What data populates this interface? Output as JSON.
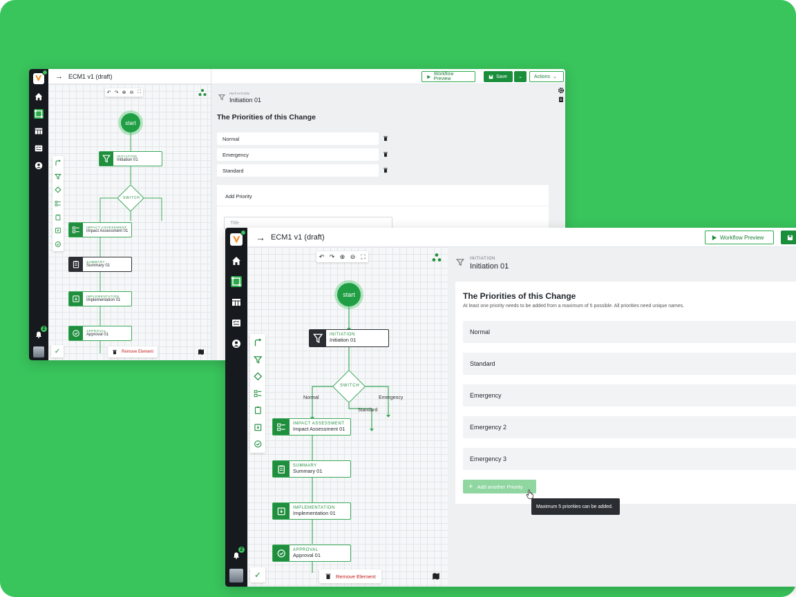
{
  "app": {
    "window_title": "ECM1 v1 (draft)",
    "notification_count": "2"
  },
  "toolbar": {
    "preview_label": "Workflow Preview",
    "save_label": "Save",
    "actions_label": "Actions"
  },
  "canvas": {
    "start_label": "start",
    "switch_label": "SWITCH",
    "remove_label": "Remove Element",
    "edge_labels": [
      "Normal",
      "Standard",
      "Emergency"
    ],
    "nodes": [
      {
        "kind": "INITIATION",
        "name": "Initiation 01",
        "icon": "filter-icon"
      },
      {
        "kind": "IMPACT ASSESSMENT",
        "name": "Impact Assessment 01",
        "icon": "checklist-icon"
      },
      {
        "kind": "SUMMARY",
        "name": "Summary 01",
        "icon": "clipboard-icon"
      },
      {
        "kind": "IMPLEMENTATION",
        "name": "Implementation 01",
        "icon": "inbox-icon"
      },
      {
        "kind": "APPROVAL",
        "name": "Approval 01",
        "icon": "check-circle-icon"
      }
    ]
  },
  "panel": {
    "step_kind": "INITIATION",
    "step_name": "Initiation 01",
    "section_title": "The Priorities of this Change",
    "helper_text": "At least one priority needs to be added from a maximum of 5 possible. All priorities need unique names.",
    "back_priorities": [
      "Normal",
      "Emergency",
      "Standard"
    ],
    "add_priority_title": "Add Priority",
    "title_placeholder": "Title",
    "front_priorities": [
      "Normal",
      "Standard",
      "Emergency",
      "Emergency 2",
      "Emergency 3"
    ],
    "add_another_label": "Add another Priority",
    "tooltip": "Maximum 5 priorities can be added."
  },
  "colors": {
    "brand_green": "#39c45c",
    "primary": "#1a8e3b",
    "rail": "#16191d",
    "danger": "#c21a1a"
  }
}
